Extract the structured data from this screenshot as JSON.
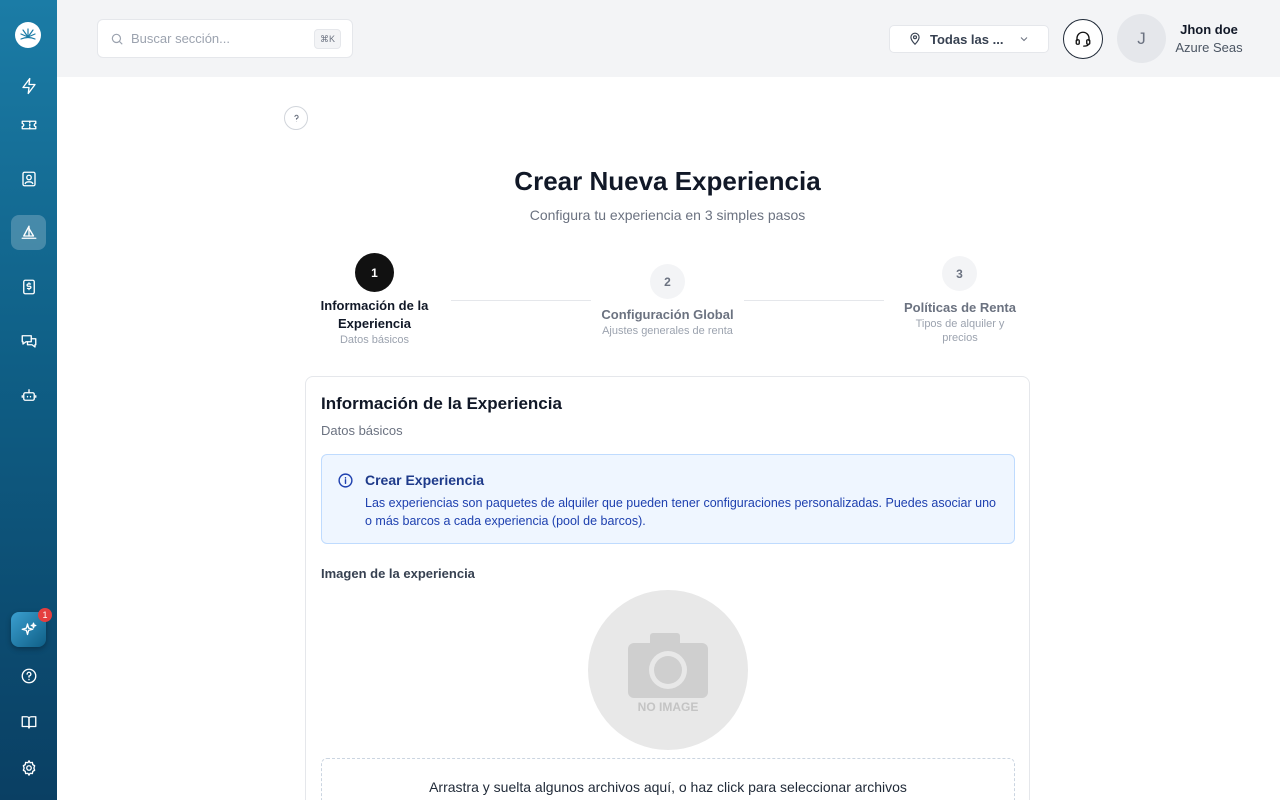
{
  "sidebar": {
    "items": [
      {
        "icon": "bolt-icon"
      },
      {
        "icon": "ticket-icon"
      },
      {
        "icon": "contact-icon"
      },
      {
        "icon": "sailboat-icon",
        "active": true
      },
      {
        "icon": "dollar-receipt-icon"
      },
      {
        "icon": "chat-icon"
      },
      {
        "icon": "bot-icon"
      }
    ],
    "ai_badge": "1"
  },
  "header": {
    "search_placeholder": "Buscar sección...",
    "search_shortcut": "⌘K",
    "location": "Todas las ...",
    "avatar_initial": "J",
    "user_name": "Jhon doe",
    "user_org": "Azure Seas"
  },
  "main": {
    "title": "Crear Nueva Experiencia",
    "subtitle": "Configura tu experiencia en 3 simples pasos",
    "steps": [
      {
        "number": "1",
        "label": "Información de la Experiencia",
        "desc": "Datos básicos",
        "active": true
      },
      {
        "number": "2",
        "label": "Configuración Global",
        "desc": "Ajustes generales de renta",
        "active": false
      },
      {
        "number": "3",
        "label": "Políticas de Renta",
        "desc": "Tipos de alquiler y precios",
        "active": false
      }
    ],
    "card": {
      "title": "Información de la Experiencia",
      "subtitle": "Datos básicos",
      "info_title": "Crear Experiencia",
      "info_text": "Las experiencias son paquetes de alquiler que pueden tener configuraciones personalizadas. Puedes asociar uno o más barcos a cada experiencia (pool de barcos).",
      "image_label": "Imagen de la experiencia",
      "no_image_text": "NO IMAGE",
      "dropzone_text": "Arrastra y suelta algunos archivos aquí, o haz click para seleccionar archivos"
    }
  },
  "colors": {
    "sidebar_top": "#1b7ca6",
    "sidebar_bottom": "#0a3f63",
    "info_bg": "#eff6ff",
    "info_text": "#1e40af"
  }
}
